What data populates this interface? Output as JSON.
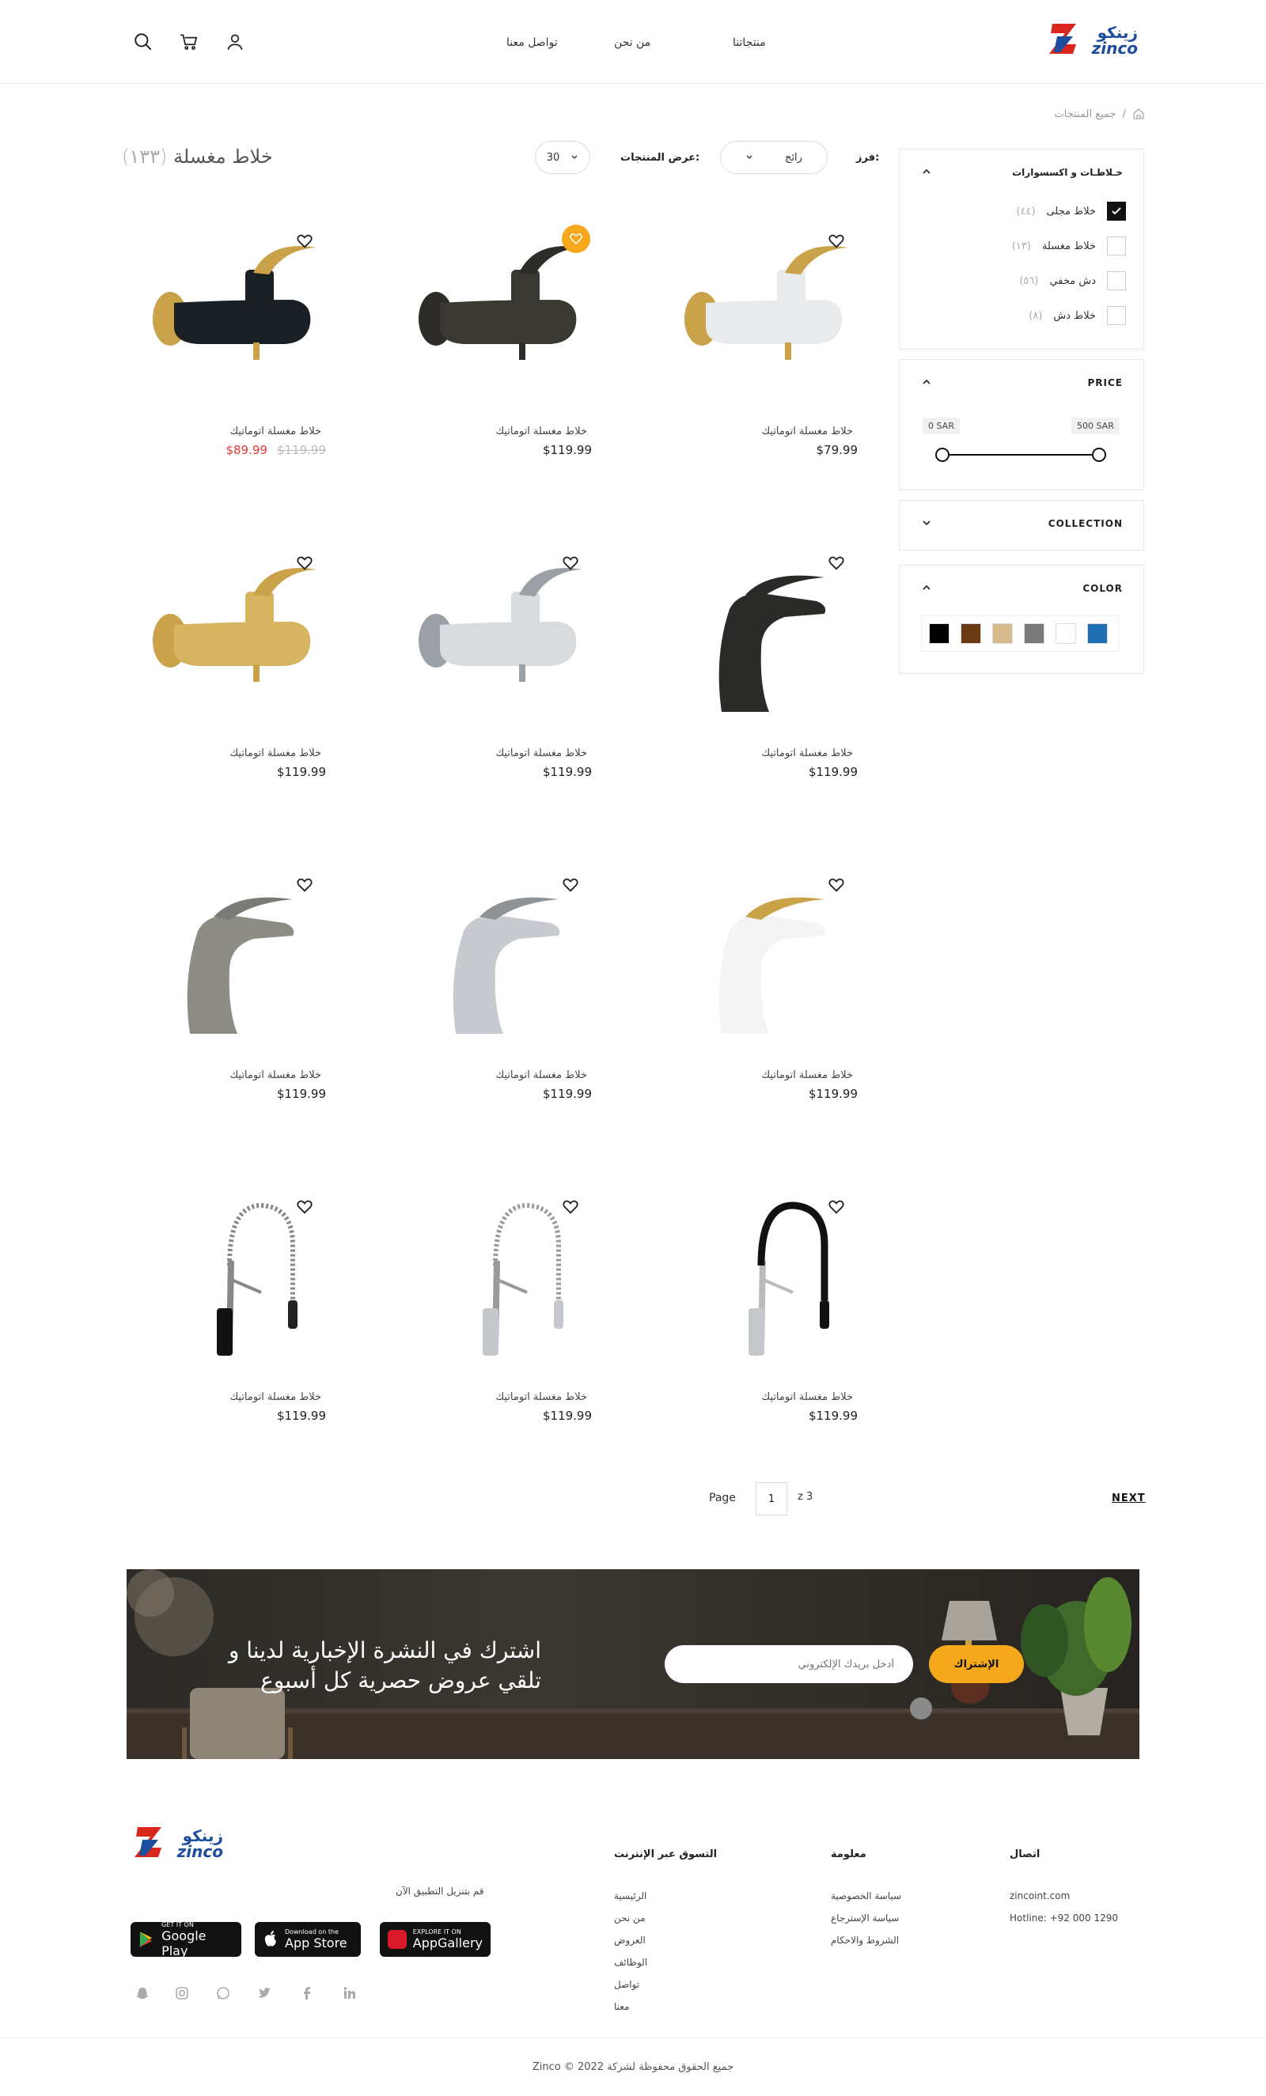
{
  "header": {
    "nav": [
      "منتجاتنا",
      "من نحن",
      "تواصل معنا"
    ],
    "logo_ar": "زينكو",
    "logo_en": "zinco"
  },
  "breadcrumb": {
    "current": "جميع المنتجات",
    "separator": "/"
  },
  "toolbar": {
    "title": "خلاط مغسلة",
    "count": "(١٣٣)",
    "per_page_label": "عرض المنتجات:",
    "per_page_value": "30",
    "sort_label": "فرز:",
    "sort_value": "رائج"
  },
  "products": [
    {
      "name": "خلاط مغسلة اتوماتيك",
      "price": "$89.99",
      "old_price": "$119.99",
      "wish_active": false
    },
    {
      "name": "خلاط مغسلة اتوماتيك",
      "price": "$119.99",
      "old_price": "",
      "wish_active": true
    },
    {
      "name": "خلاط مغسلة اتوماتيك",
      "price": "$79.99",
      "old_price": "",
      "wish_active": false
    },
    {
      "name": "خلاط مغسلة اتوماتيك",
      "price": "$119.99",
      "old_price": "",
      "wish_active": false
    },
    {
      "name": "خلاط مغسلة اتوماتيك",
      "price": "$119.99",
      "old_price": "",
      "wish_active": false
    },
    {
      "name": "خلاط مغسلة اتوماتيك",
      "price": "$119.99",
      "old_price": "",
      "wish_active": false
    },
    {
      "name": "خلاط مغسلة اتوماتيك",
      "price": "$119.99",
      "old_price": "",
      "wish_active": false
    },
    {
      "name": "خلاط مغسلة اتوماتيك",
      "price": "$119.99",
      "old_price": "",
      "wish_active": false
    },
    {
      "name": "خلاط مغسلة اتوماتيك",
      "price": "$119.99",
      "old_price": "",
      "wish_active": false
    },
    {
      "name": "خلاط مغسلة اتوماتيك",
      "price": "$119.99",
      "old_price": "",
      "wish_active": false
    },
    {
      "name": "خلاط مغسلة اتوماتيك",
      "price": "$119.99",
      "old_price": "",
      "wish_active": false
    },
    {
      "name": "خلاط مغسلة اتوماتيك",
      "price": "$119.99",
      "old_price": "",
      "wish_active": false
    }
  ],
  "filters": {
    "category": {
      "title": "خـلاطـات و اكسسوارات",
      "items": [
        {
          "label": "خلاط مجلى",
          "count": "(٤٤)",
          "checked": true
        },
        {
          "label": "خلاط مغسلة",
          "count": "(١٣)",
          "checked": false
        },
        {
          "label": "دش مخفي",
          "count": "(٥٦)",
          "checked": false
        },
        {
          "label": "خلاط دش",
          "count": "(٨)",
          "checked": false
        }
      ]
    },
    "price": {
      "title": "PRICE",
      "min": "0 SAR",
      "max": "500 SAR"
    },
    "collection": {
      "title": "COLLECTION"
    },
    "color": {
      "title": "COLOR",
      "swatches": [
        "#000000",
        "#6b3a14",
        "#d8bb8c",
        "#7a7a7a",
        "#ffffff",
        "#1f6fb2"
      ]
    }
  },
  "pagination": {
    "label": "Page",
    "current": "1",
    "of": "z 3",
    "next": "NEXT"
  },
  "newsletter": {
    "heading": "اشترك في النشرة الإخبارية لدينا و تلقي عروض حصرية كل أسبوع",
    "placeholder": "أدخل بريدك الإلكتروني",
    "button": "الإشتراك"
  },
  "footer": {
    "contact": {
      "title": "اتصال",
      "email": "zincoint.com",
      "hotline": "Hotline: +92 000 1290"
    },
    "info": {
      "title": "معلومة",
      "links": [
        "سياسة الخصوصية",
        "سياسة الإسترجاع",
        "الشروط والاحكام"
      ]
    },
    "shop": {
      "title": "التسوق عبر الإنترنت",
      "links": [
        "الرئيسية",
        "من نحن",
        "العروض",
        "الوظائف",
        "تواصل",
        "معنا"
      ]
    },
    "app_text": "قم بتنزيل التطبيق الآن",
    "stores": [
      {
        "small": "GET IT ON",
        "big": "Google Play"
      },
      {
        "small": "Download on the",
        "big": "App Store"
      },
      {
        "small": "EXPLORE IT ON",
        "big": "AppGallery"
      }
    ],
    "copyright": "Zinco © 2022 جميع الحقوق محفوظة لشركة"
  }
}
